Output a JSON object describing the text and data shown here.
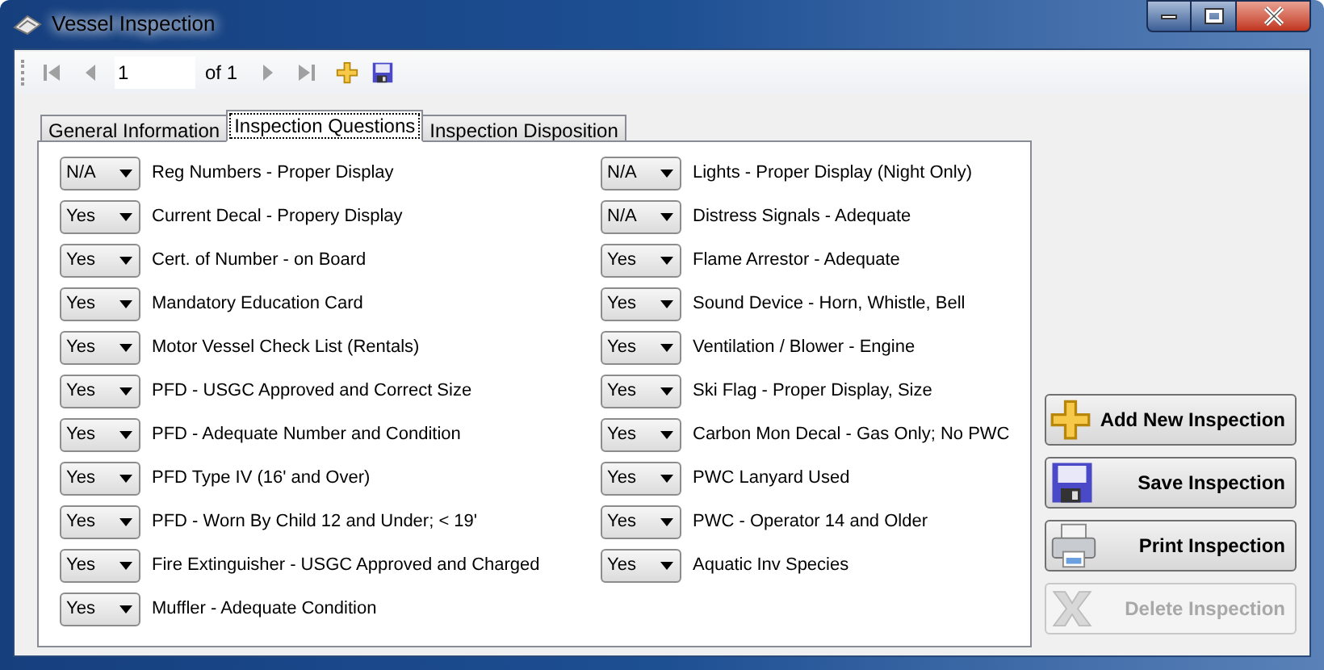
{
  "window": {
    "title": "Vessel Inspection"
  },
  "toolbar": {
    "items": [
      {
        "kind": "first",
        "disabled": true
      },
      {
        "kind": "prev",
        "disabled": true
      },
      {
        "kind": "position",
        "value": "1"
      },
      {
        "kind": "count",
        "text": "of 1"
      },
      {
        "kind": "next",
        "disabled": true
      },
      {
        "kind": "last",
        "disabled": true
      },
      {
        "kind": "add",
        "disabled": false
      },
      {
        "kind": "save",
        "disabled": false
      }
    ]
  },
  "tabs": [
    {
      "label": "General Information",
      "selected": false
    },
    {
      "label": "Inspection Questions",
      "selected": true
    },
    {
      "label": "Inspection Disposition",
      "selected": false
    }
  ],
  "questions_left": [
    {
      "answer": "N/A",
      "label": "Reg Numbers - Proper Display"
    },
    {
      "answer": "Yes",
      "label": "Current Decal - Propery Display"
    },
    {
      "answer": "Yes",
      "label": "Cert. of Number - on Board"
    },
    {
      "answer": "Yes",
      "label": "Mandatory Education Card"
    },
    {
      "answer": "Yes",
      "label": "Motor Vessel Check List (Rentals)"
    },
    {
      "answer": "Yes",
      "label": "PFD - USGC Approved and Correct Size"
    },
    {
      "answer": "Yes",
      "label": "PFD - Adequate Number and Condition"
    },
    {
      "answer": "Yes",
      "label": "PFD Type IV (16' and Over)"
    },
    {
      "answer": "Yes",
      "label": "PFD - Worn By Child 12 and Under; < 19'"
    },
    {
      "answer": "Yes",
      "label": "Fire Extinguisher - USGC Approved and Charged"
    },
    {
      "answer": "Yes",
      "label": "Muffler - Adequate Condition"
    }
  ],
  "questions_right": [
    {
      "answer": "N/A",
      "label": "Lights - Proper Display (Night Only)"
    },
    {
      "answer": "N/A",
      "label": "Distress Signals - Adequate"
    },
    {
      "answer": "Yes",
      "label": "Flame Arrestor - Adequate"
    },
    {
      "answer": "Yes",
      "label": "Sound Device - Horn, Whistle, Bell"
    },
    {
      "answer": "Yes",
      "label": "Ventilation / Blower - Engine"
    },
    {
      "answer": "Yes",
      "label": "Ski Flag - Proper Display, Size"
    },
    {
      "answer": "Yes",
      "label": "Carbon Mon Decal - Gas Only; No PWC"
    },
    {
      "answer": "Yes",
      "label": "PWC Lanyard Used"
    },
    {
      "answer": "Yes",
      "label": "PWC - Operator 14 and Older"
    },
    {
      "answer": "Yes",
      "label": "Aquatic Inv Species"
    }
  ],
  "buttons": [
    {
      "kind": "add",
      "label": "Add New Inspection",
      "disabled": false
    },
    {
      "kind": "save",
      "label": "Save Inspection",
      "disabled": false
    },
    {
      "kind": "print",
      "label": "Print Inspection",
      "disabled": false
    },
    {
      "kind": "delete",
      "label": "Delete Inspection",
      "disabled": true
    }
  ]
}
